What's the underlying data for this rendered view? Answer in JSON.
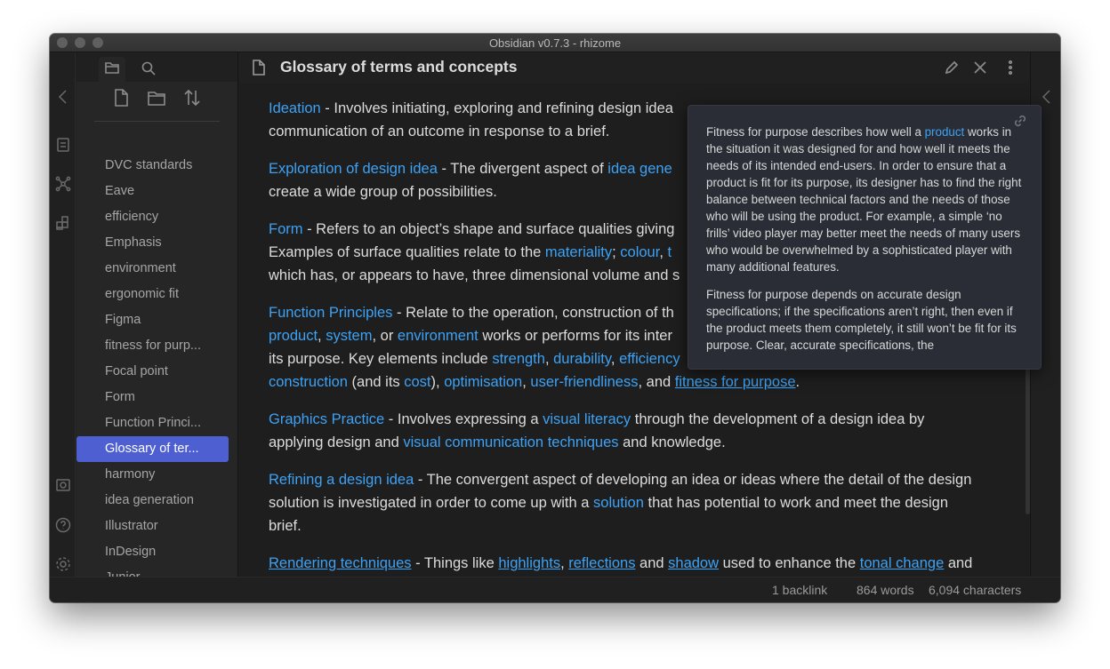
{
  "window": {
    "title": "Obsidian v0.7.3 - rhizome"
  },
  "sidebar": {
    "files": [
      {
        "label": "DVC standards",
        "active": false
      },
      {
        "label": "Eave",
        "active": false
      },
      {
        "label": "efficiency",
        "active": false
      },
      {
        "label": "Emphasis",
        "active": false
      },
      {
        "label": "environment",
        "active": false
      },
      {
        "label": "ergonomic fit",
        "active": false
      },
      {
        "label": "Figma",
        "active": false
      },
      {
        "label": "fitness for purp...",
        "active": false
      },
      {
        "label": "Focal point",
        "active": false
      },
      {
        "label": "Form",
        "active": false
      },
      {
        "label": "Function Princi...",
        "active": false
      },
      {
        "label": "Glossary of ter...",
        "active": true
      },
      {
        "label": "harmony",
        "active": false
      },
      {
        "label": "idea generation",
        "active": false
      },
      {
        "label": "Illustrator",
        "active": false
      },
      {
        "label": "InDesign",
        "active": false
      },
      {
        "label": "Junior",
        "active": false
      }
    ]
  },
  "editor": {
    "title": "Glossary of terms and concepts",
    "paragraphs": [
      {
        "segments": [
          {
            "t": "Ideation",
            "link": true
          },
          {
            "t": " - Involves initiating, exploring and refining design idea"
          },
          {
            "br": true
          },
          {
            "t": "communication of an outcome in response to a brief."
          }
        ]
      },
      {
        "segments": [
          {
            "t": "Exploration of design idea",
            "link": true
          },
          {
            "t": " - The divergent aspect of "
          },
          {
            "t": "idea gene",
            "link": true
          },
          {
            "br": true
          },
          {
            "t": "create a wide group of possibilities."
          }
        ]
      },
      {
        "segments": [
          {
            "t": "Form",
            "link": true
          },
          {
            "t": " - Refers to an object’s shape and surface qualities giving"
          },
          {
            "br": true
          },
          {
            "t": "Examples of surface qualities relate to the "
          },
          {
            "t": "materiality",
            "link": true
          },
          {
            "t": "; "
          },
          {
            "t": "colour",
            "link": true
          },
          {
            "t": ", "
          },
          {
            "t": "t",
            "link": true
          },
          {
            "br": true
          },
          {
            "t": "which has, or appears to have, three dimensional volume and s"
          }
        ]
      },
      {
        "segments": [
          {
            "t": "Function Principles",
            "link": true
          },
          {
            "t": " - Relate to the operation, construction of th"
          },
          {
            "br": true
          },
          {
            "t": "product",
            "link": true
          },
          {
            "t": ", "
          },
          {
            "t": "system",
            "link": true
          },
          {
            "t": ", or "
          },
          {
            "t": "environment",
            "link": true
          },
          {
            "t": " works or performs for its inter"
          },
          {
            "br": true
          },
          {
            "t": "its purpose. Key elements include "
          },
          {
            "t": "strength",
            "link": true
          },
          {
            "t": ", "
          },
          {
            "t": "durability",
            "link": true
          },
          {
            "t": ", "
          },
          {
            "t": "efficiency",
            "link": true
          },
          {
            "br": true
          },
          {
            "t": "construction",
            "link": true
          },
          {
            "t": " (and its "
          },
          {
            "t": "cost",
            "link": true
          },
          {
            "t": "), "
          },
          {
            "t": "optimisation",
            "link": true
          },
          {
            "t": ", "
          },
          {
            "t": "user-friendliness",
            "link": true
          },
          {
            "t": ", and "
          },
          {
            "t": "fitness for purpose",
            "link": true,
            "underline": true
          },
          {
            "t": "."
          }
        ]
      },
      {
        "segments": [
          {
            "t": "Graphics Practice",
            "link": true
          },
          {
            "t": " - Involves expressing a "
          },
          {
            "t": "visual literacy",
            "link": true
          },
          {
            "t": " through the development of a design idea by"
          },
          {
            "br": true
          },
          {
            "t": "applying design and "
          },
          {
            "t": "visual communication techniques",
            "link": true
          },
          {
            "t": " and knowledge."
          }
        ]
      },
      {
        "segments": [
          {
            "t": "Refining a design idea",
            "link": true
          },
          {
            "t": " - The convergent aspect of developing an idea or ideas where the detail of the design"
          },
          {
            "br": true
          },
          {
            "t": "solution is investigated in order to come up with a "
          },
          {
            "t": "solution",
            "link": true
          },
          {
            "t": " that has potential to work and meet the design"
          },
          {
            "br": true
          },
          {
            "t": "brief."
          }
        ]
      },
      {
        "segments": [
          {
            "t": "Rendering techniques",
            "link": true,
            "underline": true
          },
          {
            "t": " - Things like "
          },
          {
            "t": "highlights",
            "link": true,
            "underline": true
          },
          {
            "t": ", "
          },
          {
            "t": "reflections",
            "link": true,
            "underline": true
          },
          {
            "t": " and "
          },
          {
            "t": "shadow",
            "link": true,
            "underline": true
          },
          {
            "t": " used to enhance the "
          },
          {
            "t": "tonal change",
            "link": true,
            "underline": true
          },
          {
            "t": " and"
          }
        ]
      }
    ]
  },
  "popover": {
    "paragraphs": [
      {
        "segments": [
          {
            "t": "Fitness for purpose describes how well a "
          },
          {
            "t": "product",
            "link": true
          },
          {
            "t": " works in the situation it was designed for and how well it meets the needs of its intended end-users. In order to ensure that a product is fit for its purpose, its designer has to find the right balance between technical factors and the needs of those who will be using the product. For example, a simple ‘no frills’ video player may better meet the needs of many users who would be overwhelmed by a sophisticated player with many additional features."
          }
        ]
      },
      {
        "segments": [
          {
            "t": "Fitness for purpose depends on accurate design specifications; if the specifications aren’t right, then even if the product meets them completely, it still won’t be fit for its purpose. Clear, accurate specifications, the"
          }
        ]
      }
    ]
  },
  "status": {
    "backlinks": "1 backlink",
    "words": "864 words",
    "characters": "6,094 characters"
  },
  "colors": {
    "accent": "#4d5fd1",
    "link": "#3da2f5"
  },
  "icons": [
    "folder-icon",
    "search-icon",
    "new-note-icon",
    "new-folder-icon",
    "sort-icon",
    "collapse-left-icon",
    "collapse-right-icon",
    "edit-icon",
    "close-icon",
    "more-icon",
    "link-icon",
    "graph-icon",
    "settings-icon",
    "help-icon",
    "vault-icon"
  ]
}
